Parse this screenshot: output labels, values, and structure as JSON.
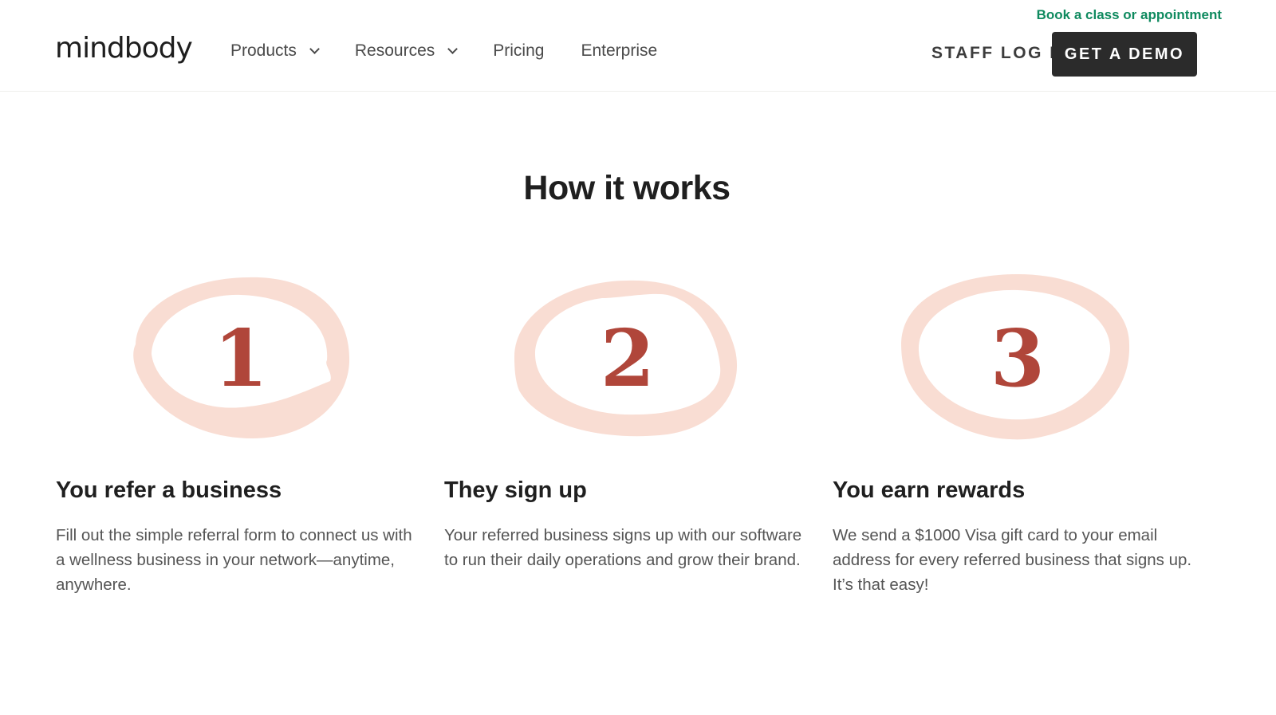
{
  "header": {
    "top_link": "Book a class or appointment",
    "logo": "mindbody",
    "nav": [
      {
        "label": "Products",
        "dropdown": true
      },
      {
        "label": "Resources",
        "dropdown": true
      },
      {
        "label": "Pricing",
        "dropdown": false
      },
      {
        "label": "Enterprise",
        "dropdown": false
      }
    ],
    "staff_login": "STAFF LOG IN",
    "demo_button": "GET A DEMO"
  },
  "main": {
    "title": "How it works",
    "steps": [
      {
        "number": "1",
        "heading": "You refer a business",
        "text": "Fill out the simple referral form to connect us with a wellness business in your network—anytime, anywhere."
      },
      {
        "number": "2",
        "heading": "They sign up",
        "text": "Your referred business signs up with our software to run their daily operations and grow their brand."
      },
      {
        "number": "3",
        "heading": "You earn rewards",
        "text": "We send a $1000 Visa gift card to your email address for every referred business that signs up. It’s that easy!"
      }
    ]
  },
  "colors": {
    "accent_green": "#0f8a5f",
    "number_red": "#b0463a",
    "circle_pink": "#f9ddd3",
    "button_dark": "#2b2b2b"
  }
}
